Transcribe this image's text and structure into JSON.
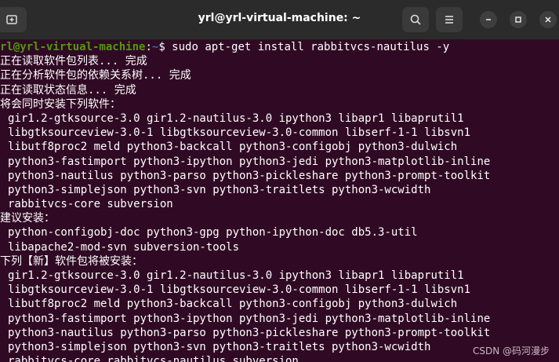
{
  "window": {
    "title": "yrl@yrl-virtual-machine: ~",
    "icons": {
      "new_tab": "new-tab-icon",
      "search": "search-icon",
      "menu": "hamburger-menu-icon",
      "minimize": "minimize-icon",
      "maximize": "maximize-icon",
      "close": "close-icon"
    }
  },
  "prompt": {
    "user_host": "rl@yrl-virtual-machine",
    "separator": ":",
    "path": "~",
    "symbol": "$ ",
    "command": "sudo apt-get install rabbitvcs-nautilus -y"
  },
  "output": [
    "正在读取软件包列表... 完成",
    "正在分析软件包的依赖关系树... 完成",
    "正在读取状态信息... 完成",
    "将会同时安装下列软件：",
    "gir1.2-gtksource-3.0 gir1.2-nautilus-3.0 ipython3 libapr1 libaprutil1",
    "libgtksourceview-3.0-1 libgtksourceview-3.0-common libserf-1-1 libsvn1",
    "libutf8proc2 meld python3-backcall python3-configobj python3-dulwich",
    "python3-fastimport python3-ipython python3-jedi python3-matplotlib-inline",
    "python3-nautilus python3-parso python3-pickleshare python3-prompt-toolkit",
    "python3-simplejson python3-svn python3-traitlets python3-wcwidth",
    "rabbitvcs-core subversion",
    "建议安装：",
    "python-configobj-doc python3-gpg python-ipython-doc db5.3-util",
    "libapache2-mod-svn subversion-tools",
    "下列【新】软件包将被安装：",
    "gir1.2-gtksource-3.0 gir1.2-nautilus-3.0 ipython3 libapr1 libaprutil1",
    "libgtksourceview-3.0-1 libgtksourceview-3.0-common libserf-1-1 libsvn1",
    "libutf8proc2 meld python3-backcall python3-configobj python3-dulwich",
    "python3-fastimport python3-ipython python3-jedi python3-matplotlib-inline",
    "python3-nautilus python3-parso python3-pickleshare python3-prompt-toolkit",
    "python3-simplejson python3-svn python3-traitlets python3-wcwidth",
    "rabbitvcs-core rabbitvcs-nautilus subversion"
  ],
  "watermark": "CSDN @码河漫步",
  "colors": {
    "background": "#300a24",
    "prompt_user": "#4e9a06",
    "prompt_path": "#3465a4",
    "titlebar": "#2b2b2b"
  }
}
